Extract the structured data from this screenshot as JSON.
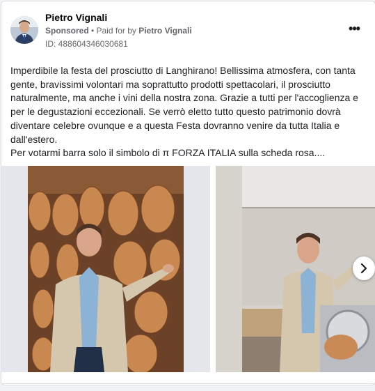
{
  "post": {
    "author_name": "Pietro Vignali",
    "sponsored_label": "Sponsored",
    "separator": " • ",
    "paid_for_prefix": "Paid for by ",
    "paid_for_name": "Pietro Vignali",
    "ad_id": "ID: 488604346030681",
    "more_icon_glyph": "•••",
    "text_paragraph_1": "Imperdibile la festa del prosciutto di Langhirano! Bellissima atmosfera, con tanta gente, bravissimi volontari ma soprattutto prodotti spettacolari, il prosciutto naturalmente, ma anche i vini della nostra zona. Grazie a tutti per l'accoglienza e per le degustazioni eccezionali. Se verrò eletto tutto questo patrimonio dovrà diventare celebre ovunque e a questa Festa dovranno venire da tutta Italia e dall'estero.",
    "text_paragraph_2": "Per votarmi barra solo il simbolo di π FORZA ITALIA sulla scheda rosa...."
  },
  "carousel": {
    "next_icon": "chevron-right-icon"
  },
  "colors": {
    "background": "#f0f2f5",
    "card": "#ffffff",
    "text_primary": "#050505",
    "text_secondary": "#65676b",
    "border": "#dddfe2"
  }
}
